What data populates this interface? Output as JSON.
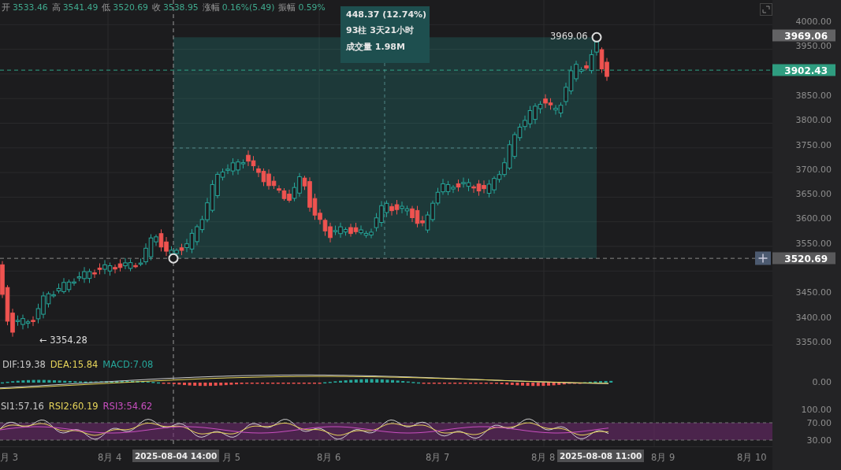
{
  "ohlc": [
    {
      "label": "开",
      "value": "3533.46"
    },
    {
      "label": "高",
      "value": "3541.49"
    },
    {
      "label": "低",
      "value": "3520.69"
    },
    {
      "label": "收",
      "value": "3538.95"
    },
    {
      "label": "涨幅",
      "value": "0.16%(5.49)"
    },
    {
      "label": "振幅",
      "value": "0.59%"
    }
  ],
  "measure": {
    "lines": [
      "448.37 (12.74%)",
      "93柱 3天21小时",
      "成交量 1.98M"
    ]
  },
  "annotations": {
    "high": "3969.06",
    "low": "← 3354.28"
  },
  "price_axis": {
    "ticks": [
      "4000.00",
      "3950.00",
      "3850.00",
      "3800.00",
      "3750.00",
      "3700.00",
      "3650.00",
      "3600.00",
      "3550.00",
      "3450.00",
      "3400.00",
      "3350.00"
    ],
    "badges": [
      {
        "kind": "high",
        "value": "3969.06"
      },
      {
        "kind": "last",
        "value": "3902.43"
      },
      {
        "kind": "crosshair",
        "value": "3520.69"
      }
    ]
  },
  "macd": {
    "legend": [
      {
        "text": "DIF:19.38",
        "color": "#c8c8c8"
      },
      {
        "text": "DEA:15.84",
        "color": "#e6d45a"
      },
      {
        "text": "MACD:7.08",
        "color": "#26a69a"
      }
    ],
    "axis": [
      "0.00"
    ]
  },
  "rsi": {
    "legend": [
      {
        "text": "SI1:57.16",
        "color": "#c8c8c8"
      },
      {
        "text": "RSI2:60.19",
        "color": "#e6d45a"
      },
      {
        "text": "RSI3:54.62",
        "color": "#c94fc0"
      }
    ],
    "axis": [
      "100.00",
      "70.00",
      "30.00"
    ]
  },
  "time_axis": {
    "labels": [
      "月 3",
      "8月 4",
      "月 5",
      "8月 6",
      "8月 7",
      "8月 8",
      "8月 9",
      "8月 10"
    ],
    "badges": [
      "2025-08-04 14:00",
      "2025-08-08 11:00"
    ]
  }
}
